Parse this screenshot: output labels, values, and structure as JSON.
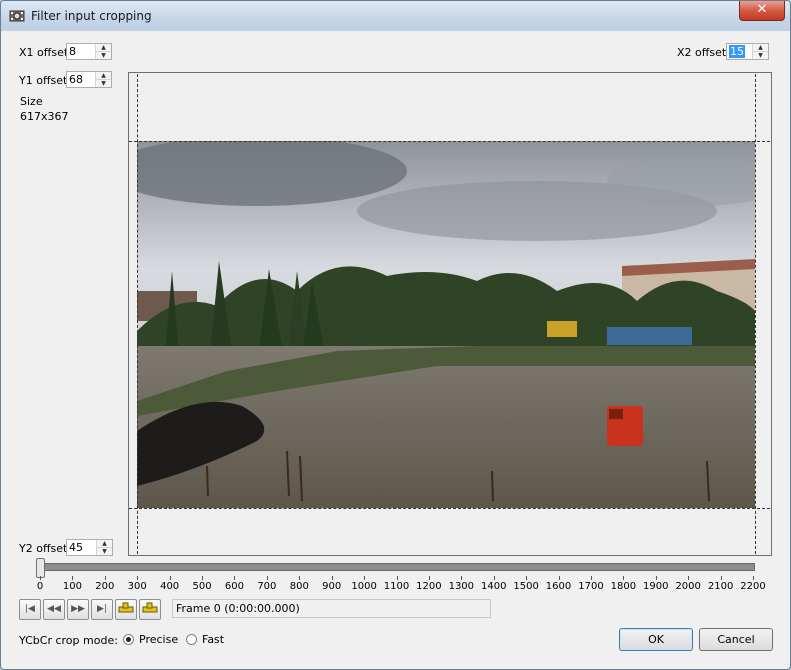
{
  "window": {
    "title": "Filter input cropping",
    "close_glyph": "✕",
    "icon": "film-gear-icon"
  },
  "offsets": {
    "x1": {
      "label": "X1 offset",
      "value": "8"
    },
    "y1": {
      "label": "Y1 offset",
      "value": "68"
    },
    "x2": {
      "label": "X2 offset",
      "value": "15"
    },
    "y2": {
      "label": "Y2 offset",
      "value": "45"
    }
  },
  "size": {
    "label": "Size",
    "value": "617x367"
  },
  "timeline": {
    "ticks": [
      "0",
      "100",
      "200",
      "300",
      "400",
      "500",
      "600",
      "700",
      "800",
      "900",
      "1000",
      "1100",
      "1200",
      "1300",
      "1400",
      "1500",
      "1600",
      "1700",
      "1800",
      "1900",
      "2000",
      "2100",
      "2200"
    ],
    "position": 0,
    "max": 2200
  },
  "transport": {
    "buttons": [
      {
        "name": "go-to-start-button",
        "glyph": "|◀"
      },
      {
        "name": "step-back-button",
        "glyph": "◀◀"
      },
      {
        "name": "step-forward-button",
        "glyph": "▶▶"
      },
      {
        "name": "go-to-end-button",
        "glyph": "▶|"
      },
      {
        "name": "prev-keyframe-button",
        "glyph": "key"
      },
      {
        "name": "next-keyframe-button",
        "glyph": "key"
      }
    ],
    "frame_text": "Frame 0 (0:00:00.000)"
  },
  "crop_mode": {
    "label": "YCbCr crop mode:",
    "options": [
      {
        "label": "Precise",
        "checked": true
      },
      {
        "label": "Fast",
        "checked": false
      }
    ]
  },
  "buttons": {
    "ok": "OK",
    "cancel": "Cancel"
  }
}
